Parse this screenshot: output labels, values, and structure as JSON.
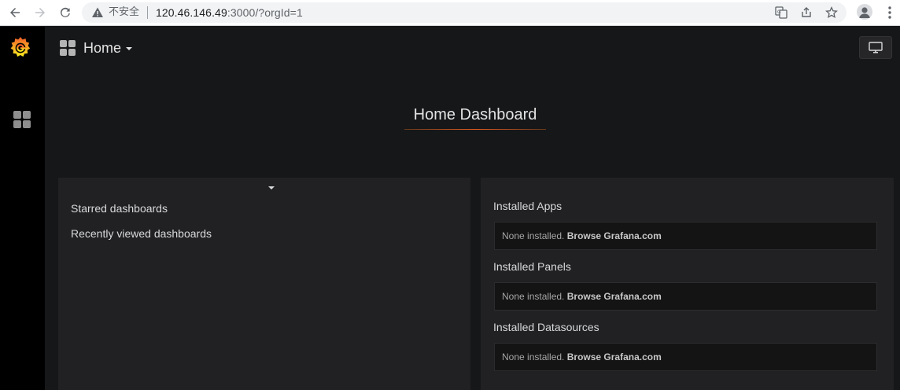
{
  "browser": {
    "security_label": "不安全",
    "url_host": "120.46.146.49",
    "url_rest": ":3000/?orgId=1"
  },
  "navbar": {
    "title": "Home"
  },
  "dashboard": {
    "title": "Home Dashboard"
  },
  "left_panel": {
    "links": [
      "Starred dashboards",
      "Recently viewed dashboards"
    ]
  },
  "right_panel": {
    "sections": [
      {
        "title": "Installed Apps",
        "empty_text": "None installed.",
        "link_text": "Browse Grafana.com"
      },
      {
        "title": "Installed Panels",
        "empty_text": "None installed.",
        "link_text": "Browse Grafana.com"
      },
      {
        "title": "Installed Datasources",
        "empty_text": "None installed.",
        "link_text": "Browse Grafana.com"
      }
    ]
  },
  "colors": {
    "accent": "#eb7b18",
    "background": "#161719",
    "panel": "#212124"
  }
}
